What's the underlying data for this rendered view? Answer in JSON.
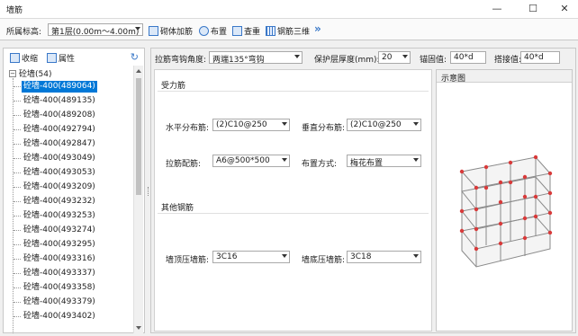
{
  "window": {
    "title": "墙筋",
    "minimize": "—",
    "maximize": "☐",
    "close": "✕"
  },
  "toolbar": {
    "floor_label": "所属标高:",
    "floor_value": "第1层(0.00m～4.00m)",
    "btn_masonry": "砌体加筋",
    "btn_layout": "布置",
    "btn_query": "查重",
    "btn_3d": "钢筋三维",
    "more": "»"
  },
  "left": {
    "collapse": "收缩",
    "properties": "属性",
    "root": "砼墙(54)",
    "toggle": "−",
    "items": [
      "砼墙-400(489064)",
      "砼墙-400(489135)",
      "砼墙-400(489208)",
      "砼墙-400(492794)",
      "砼墙-400(492847)",
      "砼墙-400(493049)",
      "砼墙-400(493053)",
      "砼墙-400(493209)",
      "砼墙-400(493232)",
      "砼墙-400(493253)",
      "砼墙-400(493274)",
      "砼墙-400(493295)",
      "砼墙-400(493316)",
      "砼墙-400(493337)",
      "砼墙-400(493358)",
      "砼墙-400(493379)",
      "砼墙-400(493402)"
    ],
    "selected_index": 0
  },
  "right": {
    "hook_label": "拉筋弯钩角度:",
    "hook_value": "两端135°弯钩",
    "cover_label": "保护层厚度(mm):",
    "cover_value": "20",
    "anchor_label": "锚固值:",
    "anchor_value": "40*d",
    "lap_label": "搭接值:",
    "lap_value": "40*d",
    "section1": "受力筋",
    "horiz_label": "水平分布筋:",
    "horiz_value": "(2)C10@250",
    "vert_label": "垂直分布筋:",
    "vert_value": "(2)C10@250",
    "tie_label": "拉筋配筋:",
    "tie_value": "A6@500*500",
    "arrange_label": "布置方式:",
    "arrange_value": "梅花布置",
    "section2": "其他钢筋",
    "top_label": "墙顶压墙筋:",
    "top_value": "3C16",
    "bottom_label": "墙底压墙筋:",
    "bottom_value": "3C18",
    "preview_title": "示意图"
  },
  "colors": {
    "accent": "#0078d7",
    "icon_blue": "#3a78c8",
    "rebar_red": "#d83a3a"
  }
}
